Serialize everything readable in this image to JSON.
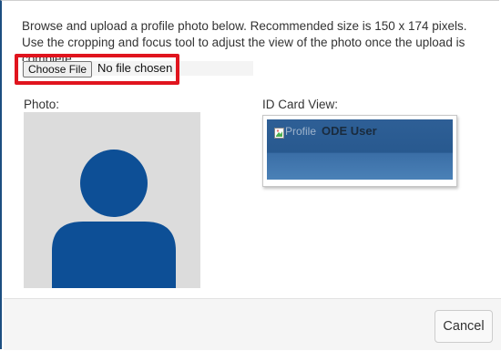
{
  "intro": {
    "text": "Browse and upload a profile photo below. Recommended size is 150 x 174 pixels. Use the cropping and focus tool to adjust the view of the photo once the upload is complete."
  },
  "file_input": {
    "button_label": "Choose File",
    "status": "No file chosen"
  },
  "photo": {
    "label": "Photo:",
    "icon": "default-avatar-icon",
    "colors": {
      "background": "#dcdcdc",
      "silhouette": "#0d4f96"
    }
  },
  "id_card": {
    "label": "ID Card View:",
    "image_alt": "Profile",
    "name": "ODE User",
    "colors": {
      "card": "#2e5f96"
    }
  },
  "footer": {
    "cancel_label": "Cancel"
  },
  "highlight": {
    "color": "#e0141e"
  }
}
